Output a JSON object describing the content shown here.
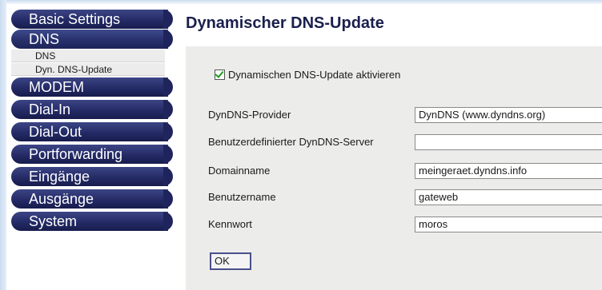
{
  "sidebar": {
    "items": [
      {
        "label": "Basic Settings"
      },
      {
        "label": "DNS"
      },
      {
        "label": "MODEM"
      },
      {
        "label": "Dial-In"
      },
      {
        "label": "Dial-Out"
      },
      {
        "label": "Portforwarding"
      },
      {
        "label": "Eingänge"
      },
      {
        "label": "Ausgänge"
      },
      {
        "label": "System"
      }
    ],
    "subitems": [
      {
        "label": "DNS"
      },
      {
        "label": "Dyn. DNS-Update"
      }
    ]
  },
  "main": {
    "title": "Dynamischer DNS-Update",
    "enable_checkbox": {
      "label": "Dynamischen DNS-Update aktivieren",
      "checked": true
    },
    "fields": [
      {
        "label": "DynDNS-Provider",
        "value": "DynDNS (www.dyndns.org)"
      },
      {
        "label": "Benutzerdefinierter DynDNS-Server",
        "value": ""
      },
      {
        "label": "Domainname",
        "value": "meingeraet.dyndns.info"
      },
      {
        "label": "Benutzername",
        "value": "gateweb"
      },
      {
        "label": "Kennwort",
        "value": "moros"
      }
    ],
    "ok_label": "OK"
  },
  "colors": {
    "nav_pill": "#242b66",
    "title_text": "#1a1f4d",
    "panel_bg": "#ececea",
    "subitem_bg": "#ececec",
    "check_mark": "#1a9a1a"
  }
}
